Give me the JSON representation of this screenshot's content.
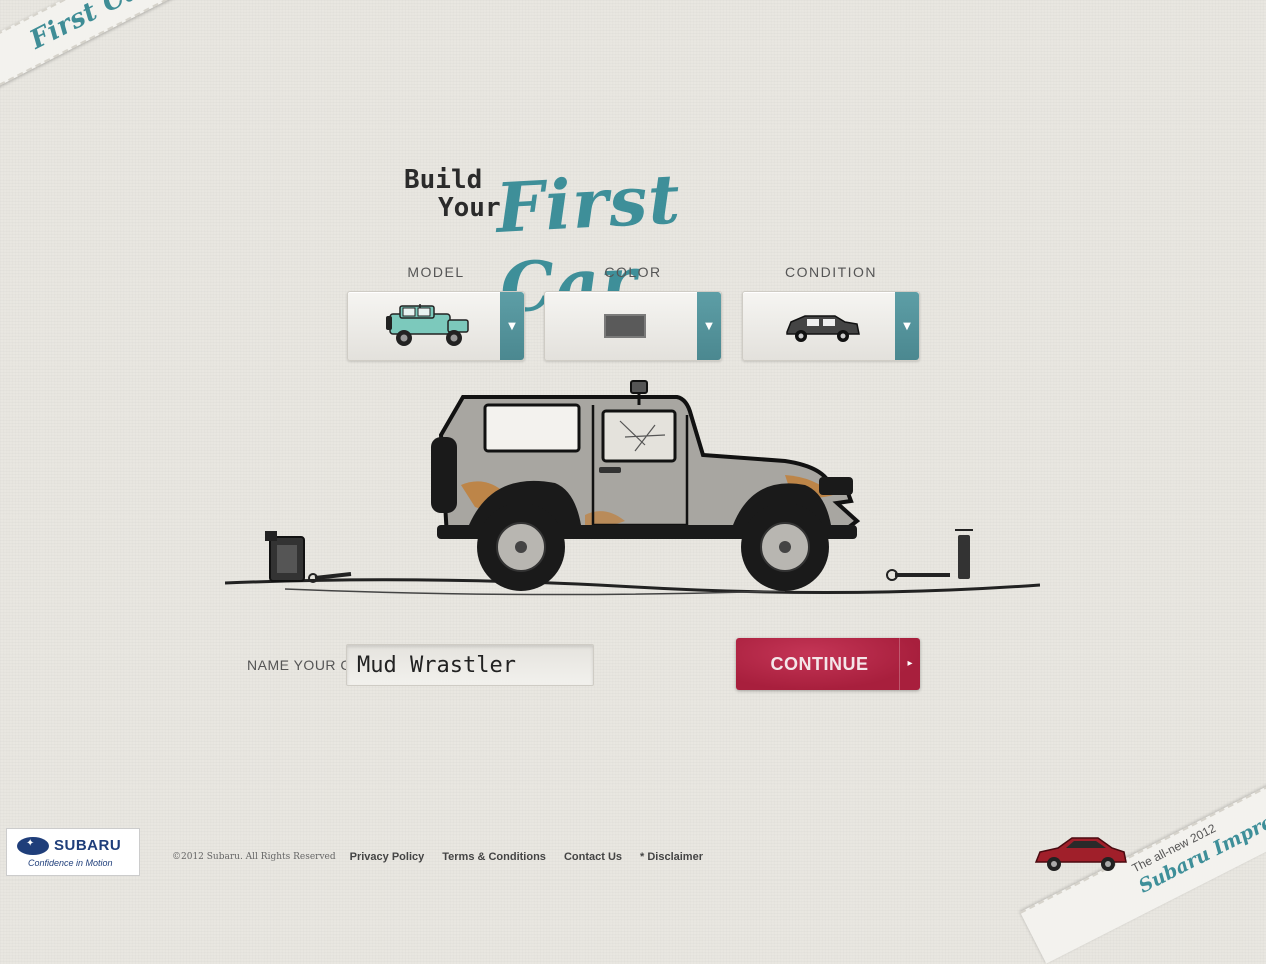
{
  "brand": {
    "corner_title": "First Car Story"
  },
  "heading": {
    "build": "Build",
    "your": "Your",
    "first_car": "First Car"
  },
  "selectors": [
    {
      "label": "MODEL",
      "value": "jeep-icon"
    },
    {
      "label": "COLOR",
      "value": "gray-swatch-icon"
    },
    {
      "label": "CONDITION",
      "value": "rusty-car-icon"
    }
  ],
  "name_field": {
    "label": "NAME YOUR CAR",
    "value": "Mud Wrastler"
  },
  "continue_button": {
    "label": "CONTINUE",
    "arrow": "▸"
  },
  "footer": {
    "logo_brand": "SUBARU",
    "logo_tagline": "Confidence in Motion",
    "copyright": "©2012 Subaru. All Rights Reserved",
    "links": [
      "Privacy Policy",
      "Terms & Conditions",
      "Contact Us",
      "* Disclaimer"
    ]
  },
  "promo": {
    "line1": "The all-new 2012",
    "line2": "Subaru Impreza"
  },
  "colors": {
    "accent_teal": "#3e8f99",
    "continue_red": "#a81f3d",
    "subaru_blue": "#1f3e7a"
  }
}
